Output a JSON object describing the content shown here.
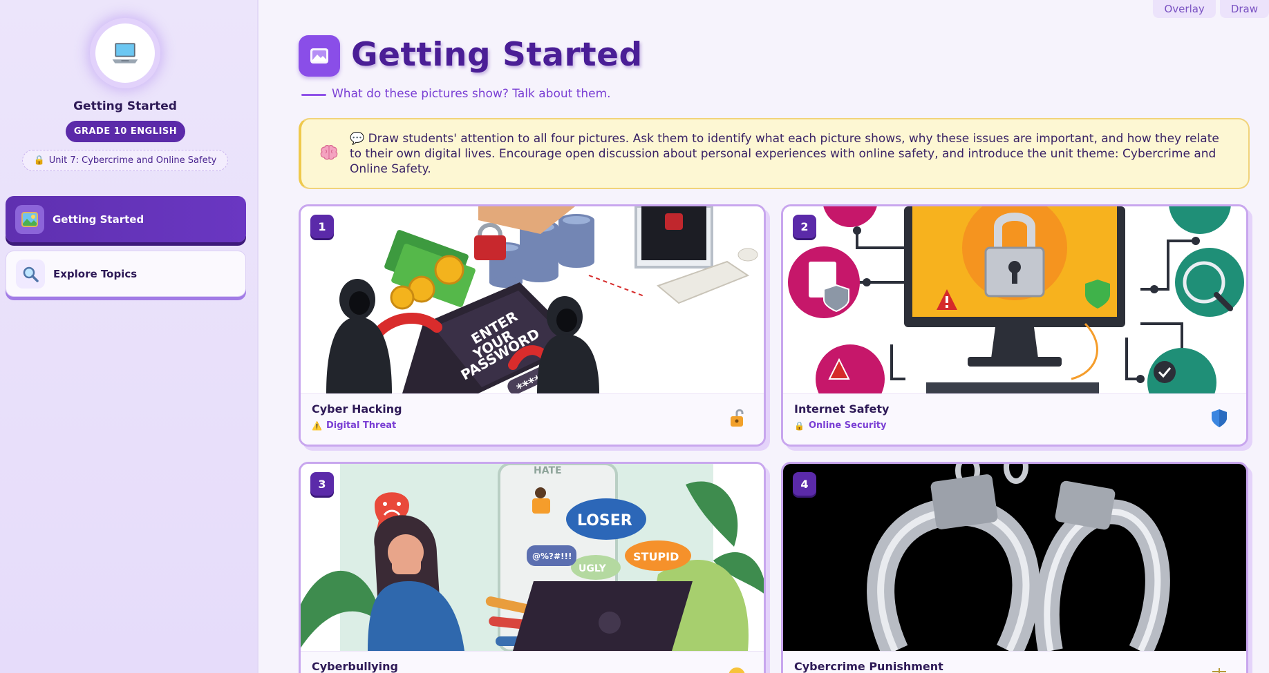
{
  "top_tabs": [
    "Overlay",
    "Draw"
  ],
  "sidebar": {
    "avatar_icon": "laptop-icon",
    "title": "Getting Started",
    "grade_badge": "GRADE 10 ENGLISH",
    "unit_chip": "Unit 7: Cybercrime and Online Safety",
    "unit_chip_icon": "lock-icon",
    "nav": [
      {
        "label": "Getting Started",
        "icon": "picture-icon",
        "active": true
      },
      {
        "label": "Explore Topics",
        "icon": "magnifier-icon",
        "active": false
      }
    ]
  },
  "header": {
    "title": "Getting Started",
    "icon": "photo-icon",
    "subtitle": "What do these pictures show? Talk about them."
  },
  "note": {
    "icon": "brain-icon",
    "speech_icon": "speech-bubble-icon",
    "text": "💬 Draw students' attention to all four pictures. Ask them to identify what each picture shows, why these issues are important, and how they relate to their own digital lives. Encourage open discussion about personal experiences with online safety, and introduce the unit theme: Cybercrime and Online Safety."
  },
  "cards": [
    {
      "number": "1",
      "title": "Cyber Hacking",
      "tag": "Digital Threat",
      "tag_icon": "warning-icon",
      "corner_icon": "unlocked-padlock-icon"
    },
    {
      "number": "2",
      "title": "Internet Safety",
      "tag": "Online Security",
      "tag_icon": "lock-icon",
      "corner_icon": "shield-icon"
    },
    {
      "number": "3",
      "title": "Cyberbullying",
      "tag": "",
      "tag_icon": "",
      "corner_icon": "sad-face-icon"
    },
    {
      "number": "4",
      "title": "Cybercrime Punishment",
      "tag": "",
      "tag_icon": "",
      "corner_icon": "scales-icon"
    }
  ],
  "image_text": {
    "card1_screen": [
      "ENTER",
      "YOUR",
      "PASSWORD",
      "****"
    ],
    "card3_bubbles": [
      "LOSER",
      "STUPID",
      "UGLY",
      "@%?#!!!",
      "HATE"
    ]
  },
  "colors": {
    "brand_purple": "#5b2aa9",
    "accent_violet": "#8a4ee8",
    "note_bg": "#fdf7d3",
    "note_border": "#f1d37a"
  }
}
